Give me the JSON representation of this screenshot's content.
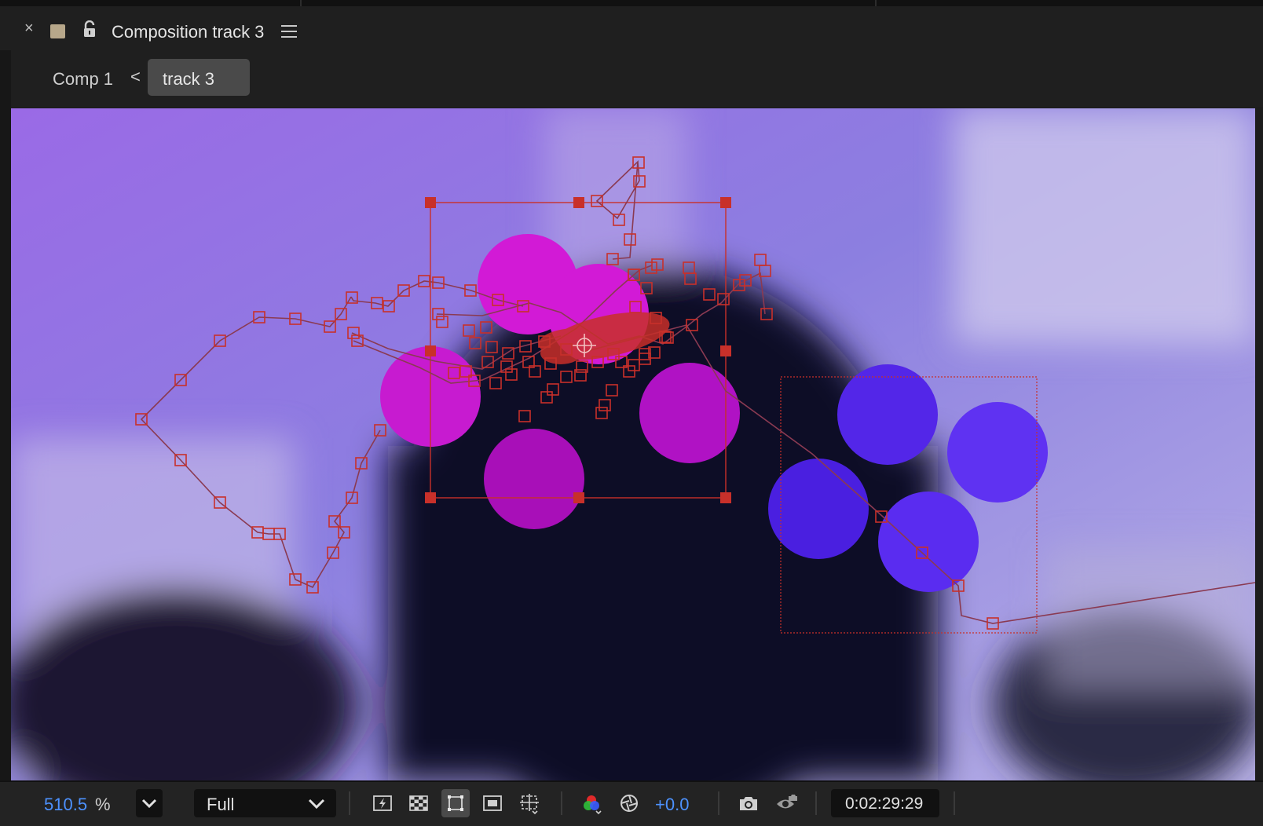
{
  "panel": {
    "title": "Composition track 3",
    "close_glyph": "×",
    "label_color": "#b7a78a"
  },
  "breadcrumbs": {
    "items": [
      {
        "label": "Comp 1",
        "active": false
      },
      {
        "label": "track 3",
        "active": true
      }
    ],
    "separator_icon": "chevron-left-icon"
  },
  "footer": {
    "zoom_value": "510.5",
    "zoom_unit": "%",
    "resolution": "Full",
    "exposure": "+0.0",
    "timecode": "0:02:29:29",
    "accent_color": "#4d92ff",
    "toolbar_icons": [
      "fast-preview-icon",
      "transparency-grid-icon",
      "mask-path-visibility-icon",
      "region-of-interest-icon",
      "grid-guides-icon",
      "channel-icon",
      "reset-exposure-icon",
      "snapshot-icon",
      "show-snapshot-icon"
    ],
    "active_tool": "mask-path-visibility-icon"
  },
  "viewer": {
    "track_color": "#c8302a",
    "layer_colors": [
      "#d21ad6",
      "#b012c4",
      "#5a2cf0"
    ]
  }
}
